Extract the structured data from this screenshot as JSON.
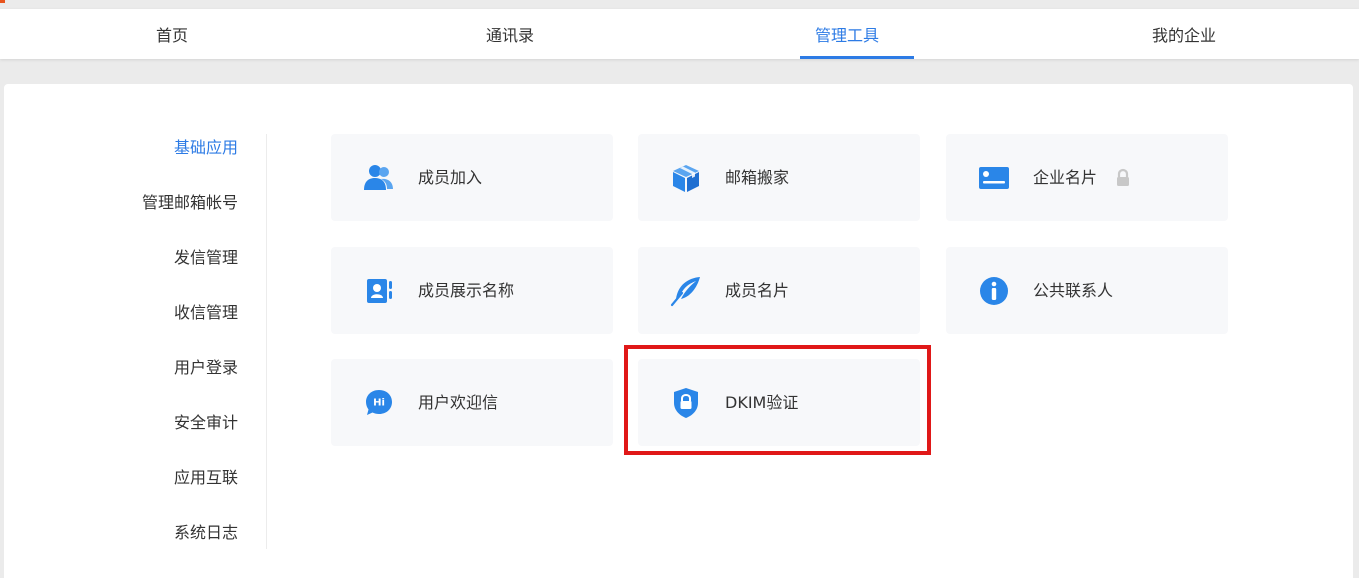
{
  "nav": {
    "tabs": [
      {
        "label": "首页"
      },
      {
        "label": "通讯录"
      },
      {
        "label": "管理工具"
      },
      {
        "label": "我的企业"
      }
    ],
    "active_tab": 2
  },
  "sidebar": {
    "items": [
      {
        "label": "基础应用"
      },
      {
        "label": "管理邮箱帐号"
      },
      {
        "label": "发信管理"
      },
      {
        "label": "收信管理"
      },
      {
        "label": "用户登录"
      },
      {
        "label": "安全审计"
      },
      {
        "label": "应用互联"
      },
      {
        "label": "系统日志"
      }
    ],
    "active_item": 0
  },
  "tools": [
    {
      "label": "成员加入",
      "icon": "users-add-icon"
    },
    {
      "label": "邮箱搬家",
      "icon": "box-icon"
    },
    {
      "label": "企业名片",
      "icon": "id-card-icon",
      "locked": true
    },
    {
      "label": "成员展示名称",
      "icon": "contact-card-icon"
    },
    {
      "label": "成员名片",
      "icon": "feather-icon"
    },
    {
      "label": "公共联系人",
      "icon": "info-icon"
    },
    {
      "label": "用户欢迎信",
      "icon": "hi-bubble-icon"
    },
    {
      "label": "DKIM验证",
      "icon": "shield-lock-icon",
      "highlighted": true
    }
  ],
  "colors": {
    "accent": "#2d7be5",
    "icon": "#2a86e8",
    "highlight": "#e01818",
    "card_bg": "#f7f8fa",
    "lock_gray": "#c8c8c8"
  }
}
